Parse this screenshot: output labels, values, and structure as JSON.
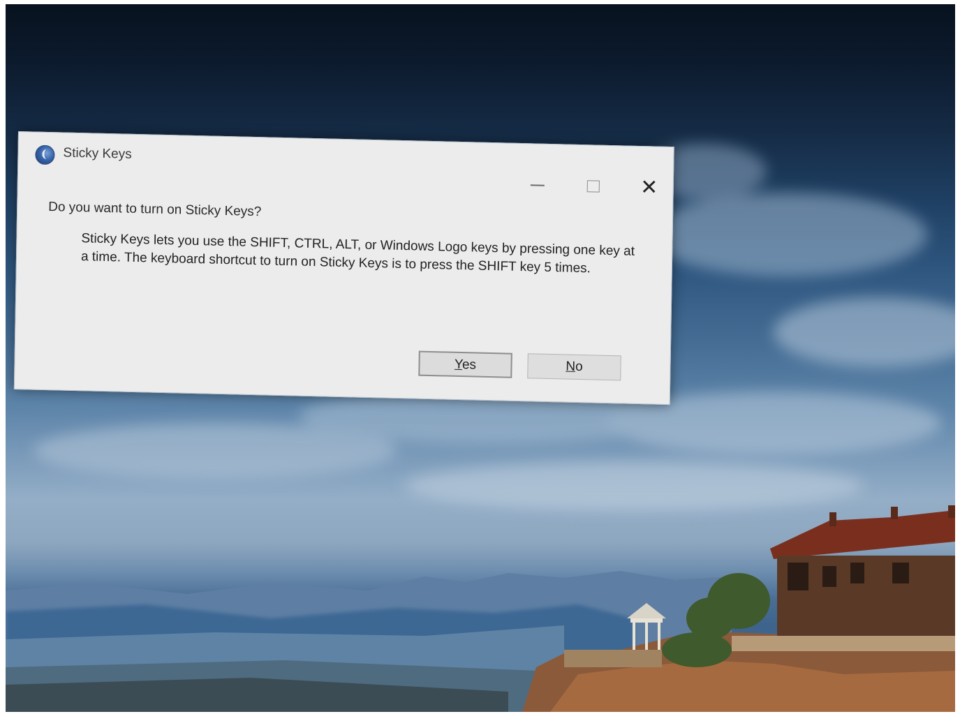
{
  "dialog": {
    "title": "Sticky Keys",
    "question": "Do you want to turn on Sticky Keys?",
    "body": "Sticky Keys lets you use the SHIFT, CTRL, ALT, or Windows Logo keys by pressing one key at a time. The keyboard shortcut to turn on Sticky Keys is to press the SHIFT key 5 times.",
    "buttons": {
      "yes": {
        "label": "Yes",
        "hotkey": "Y",
        "rest": "es"
      },
      "no": {
        "label": "No",
        "hotkey": "N",
        "rest": "o"
      }
    },
    "caption_icons": [
      "minimize-icon",
      "maximize-icon",
      "close-icon"
    ]
  },
  "desktop": {
    "wallpaper": "sky-landscape-with-hillside-town"
  },
  "colors": {
    "dialog_bg": "#ececec",
    "app_icon": "#3763a8",
    "sky_top": "#08121f",
    "sky_mid": "#5d84a9"
  }
}
